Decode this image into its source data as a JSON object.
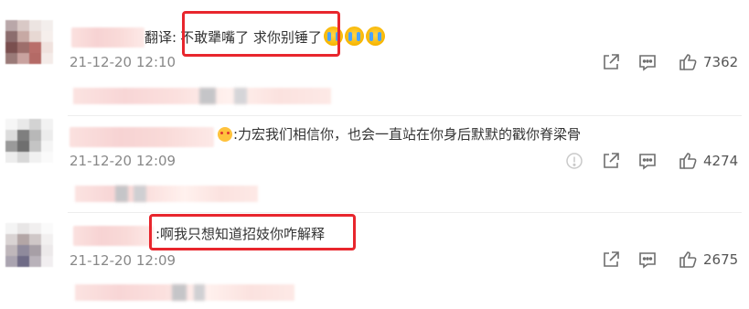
{
  "comments": [
    {
      "prefix": "翻译:",
      "content": "不敢犟嘴了 求你别锤了",
      "emojis": [
        "crying-emoji",
        "crying-emoji",
        "crying-emoji"
      ],
      "time": "21-12-20 12:10",
      "likes": "7362"
    },
    {
      "content": ":力宏我们相信你，也会一直站在你身后默默的戳你脊梁骨",
      "time": "21-12-20 12:09",
      "likes": "4274",
      "has_report_icon": true
    },
    {
      "content": ":啊我只想知道招妓你咋解释",
      "time": "21-12-20 12:09",
      "likes": "2675"
    }
  ],
  "icons": {
    "share": "share-icon",
    "comment": "comment-icon",
    "like": "thumbs-up-icon",
    "report": "report-icon"
  },
  "colors": {
    "highlight_box": "#e8262d",
    "meta_text": "#888888",
    "body_text": "#333333"
  }
}
